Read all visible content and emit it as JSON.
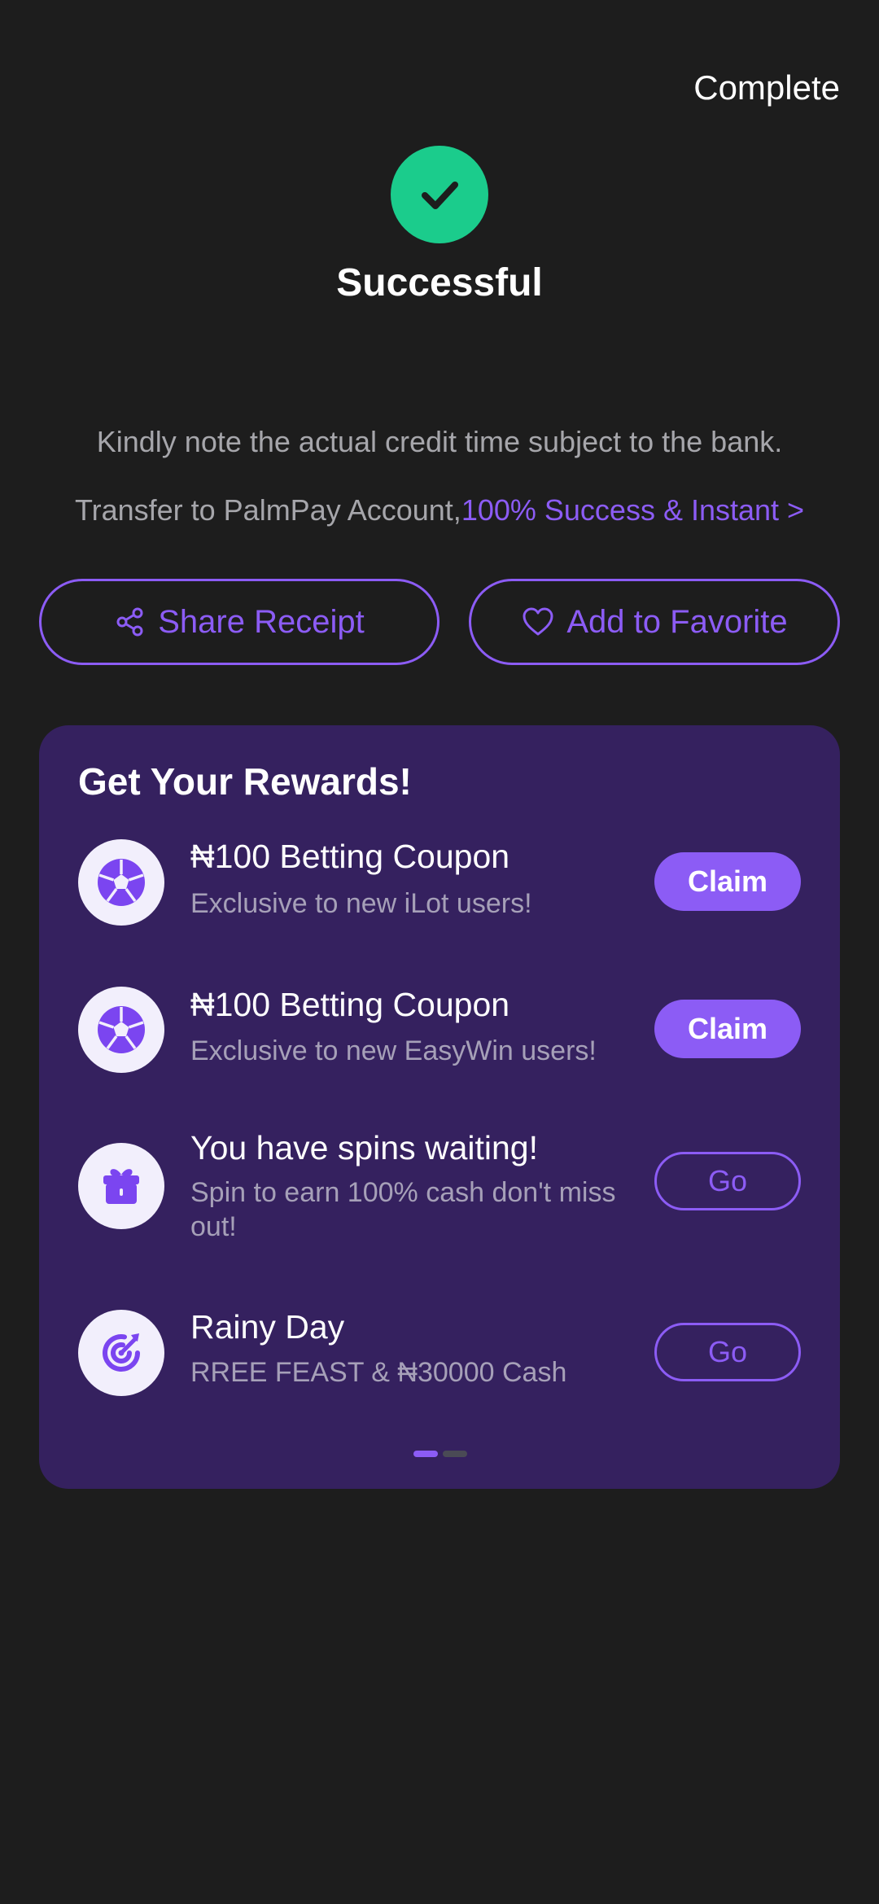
{
  "header": {
    "complete_label": "Complete"
  },
  "status": {
    "title": "Successful",
    "icon": "check-icon",
    "color": "#1bcc8c"
  },
  "note": "Kindly note the actual credit time subject to the bank.",
  "transfer": {
    "prefix": "Transfer to PalmPay Account,",
    "link": "100% Success & Instant >"
  },
  "actions": {
    "share_label": "Share Receipt",
    "favorite_label": "Add to Favorite"
  },
  "rewards": {
    "title": "Get Your Rewards!",
    "items": [
      {
        "icon": "soccer-ball-icon",
        "title": "₦100 Betting Coupon",
        "subtitle": "Exclusive to new iLot users!",
        "button": "Claim"
      },
      {
        "icon": "soccer-ball-icon",
        "title": "₦100 Betting Coupon",
        "subtitle": "Exclusive to new EasyWin users!",
        "button": "Claim"
      },
      {
        "icon": "gift-icon",
        "title": "You have spins waiting!",
        "subtitle": "Spin to earn 100% cash don't miss out!",
        "button": "Go"
      },
      {
        "icon": "target-icon",
        "title": "Rainy Day",
        "subtitle": "RREE FEAST & ₦30000 Cash",
        "button": "Go"
      }
    ],
    "pagination": {
      "current": 1,
      "total": 2
    }
  },
  "colors": {
    "background": "#1d1d1d",
    "accent": "#8c5cf5",
    "card": "#35215f",
    "success": "#1bcc8c"
  }
}
